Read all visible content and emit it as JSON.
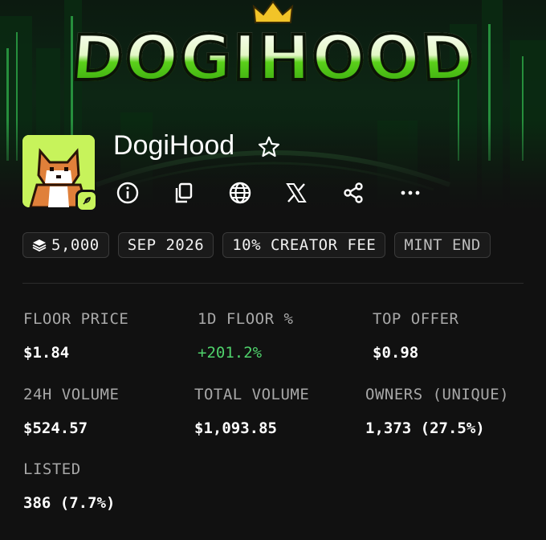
{
  "banner": {
    "logo_text": "DOGIHOOD"
  },
  "collection": {
    "name": "DogiHood"
  },
  "chips": [
    {
      "label": "5,000",
      "icon": "layers-icon"
    },
    {
      "label": "SEP 2026"
    },
    {
      "label": "10% CREATOR FEE"
    },
    {
      "label": "MINT END"
    }
  ],
  "stats": {
    "floor_price": {
      "label": "FLOOR PRICE",
      "value": "$1.84"
    },
    "floor_change_1d": {
      "label": "1D FLOOR %",
      "value": "+201.2%"
    },
    "top_offer": {
      "label": "TOP OFFER",
      "value": "$0.98"
    },
    "volume_24h": {
      "label": "24H VOLUME",
      "value": "$524.57"
    },
    "total_volume": {
      "label": "TOTAL VOLUME",
      "value": "$1,093.85"
    },
    "owners": {
      "label": "OWNERS (UNIQUE)",
      "value": "1,373 (27.5%)"
    },
    "listed": {
      "label": "LISTED",
      "value": "386 (7.7%)"
    }
  },
  "colors": {
    "positive": "#4fd16b",
    "avatar_bg": "#c7f35b",
    "background": "#111111"
  }
}
